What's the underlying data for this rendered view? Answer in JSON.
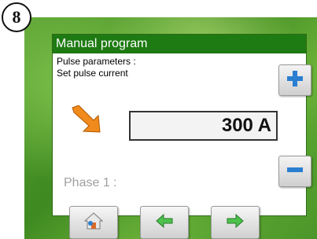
{
  "step": {
    "number": "8"
  },
  "screen": {
    "title": "Manual program",
    "line1": "Pulse parameters :",
    "line2": "Set pulse current",
    "value": "300 A",
    "phase_label": "Phase 1 :"
  },
  "icons": {
    "plus": "plus-icon",
    "minus": "minus-icon",
    "arrow": "diagonal-arrow-icon",
    "home": "home-icon",
    "back": "arrow-left-icon",
    "next": "arrow-right-icon"
  },
  "colors": {
    "title_bar": "#1e7a12",
    "accent_blue": "#2a7fd0",
    "arrow_orange": "#f08a1c",
    "nav_green": "#4cc24c"
  }
}
